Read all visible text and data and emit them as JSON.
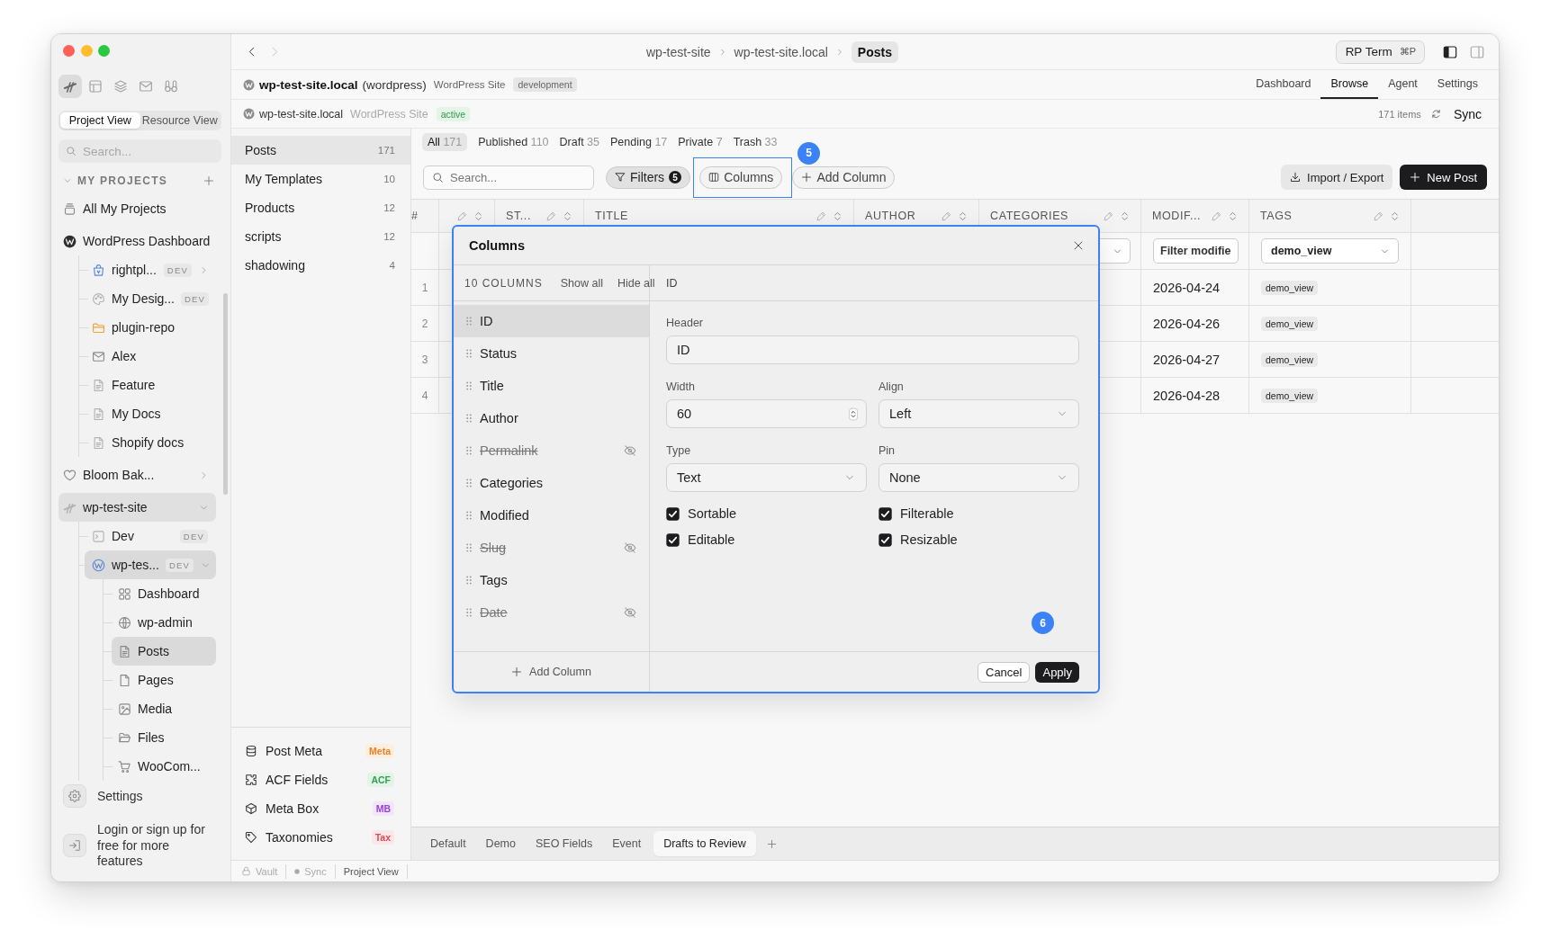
{
  "sidebar": {
    "tools": [
      {
        "kind": "logo",
        "selected": true
      },
      {
        "kind": "layout",
        "selected": false
      },
      {
        "kind": "layers",
        "selected": false
      },
      {
        "kind": "mail",
        "selected": false
      },
      {
        "kind": "binoculars",
        "selected": false
      }
    ],
    "views": [
      {
        "label": "Project View",
        "selected": true
      },
      {
        "label": "Resource View",
        "selected": false
      }
    ],
    "search": {
      "placeholder": "Search..."
    },
    "section": {
      "title": "MY PROJECTS",
      "expanded": true
    },
    "projects": [
      {
        "kind": "all",
        "label": "All My Projects",
        "selected": false
      },
      {
        "kind": "wordpress",
        "label": "WordPress Dashboard",
        "selected": false,
        "children": [
          {
            "kind": "shop",
            "label": "rightpl...",
            "badge": "DEV",
            "expanded": false,
            "selected": false
          },
          {
            "kind": "design",
            "label": "My Desig...",
            "badge": "DEV",
            "selected": false
          },
          {
            "kind": "folder",
            "label": "plugin-repo",
            "selected": false
          },
          {
            "kind": "mail",
            "label": "Alex",
            "selected": false
          },
          {
            "kind": "doc",
            "label": "Feature",
            "selected": false
          },
          {
            "kind": "doc",
            "label": "My Docs",
            "selected": false
          },
          {
            "kind": "doc",
            "label": "Shopify docs",
            "selected": false
          }
        ]
      },
      {
        "kind": "favorite",
        "label": "Bloom Bak...",
        "expanded": false,
        "selected": false
      },
      {
        "kind": "project",
        "label": "wp-test-site",
        "expanded": true,
        "selected": true,
        "children": [
          {
            "kind": "terminal",
            "label": "Dev",
            "badge": "DEV",
            "selected": false
          },
          {
            "kind": "site",
            "label": "wp-tes...",
            "badge": "DEV",
            "expanded": true,
            "selected": true,
            "children": [
              {
                "kind": "dashboard",
                "label": "Dashboard",
                "selected": false
              },
              {
                "kind": "web",
                "label": "wp-admin",
                "selected": false
              },
              {
                "kind": "posts",
                "label": "Posts",
                "selected": true
              },
              {
                "kind": "pages",
                "label": "Pages",
                "selected": false
              },
              {
                "kind": "media",
                "label": "Media",
                "selected": false
              },
              {
                "kind": "files",
                "label": "Files",
                "selected": false
              },
              {
                "kind": "store",
                "label": "WooCom...",
                "selected": false
              }
            ]
          }
        ]
      }
    ],
    "settings": {
      "label": "Settings"
    },
    "login": {
      "text": "Login or sign up for free for more features"
    }
  },
  "topbar": {
    "back": {
      "disabled": false
    },
    "forward": {
      "disabled": true
    },
    "breadcrumbs": [
      {
        "label": "wp-test-site",
        "selected": false
      },
      {
        "label": "wp-test-site.local",
        "selected": false
      },
      {
        "label": "Posts",
        "selected": true
      }
    ],
    "command": {
      "label": "RP Term",
      "shortcut": "⌘P"
    },
    "panels": [
      {
        "kind": "left",
        "on": true
      },
      {
        "kind": "right",
        "on": false
      }
    ]
  },
  "site_header": {
    "name": "wp-test-site.local",
    "platform": "(wordpress)",
    "type": "WordPress Site",
    "environment": "development",
    "tabs": [
      {
        "label": "Dashboard",
        "selected": false
      },
      {
        "label": "Browse",
        "selected": true
      },
      {
        "label": "Agent",
        "selected": false
      },
      {
        "label": "Settings",
        "selected": false
      }
    ]
  },
  "connection": {
    "name": "wp-test-site.local",
    "type": "WordPress Site",
    "status": "active",
    "count": "171 items",
    "action": "Sync"
  },
  "collections": {
    "items": [
      {
        "label": "Posts",
        "count": "171",
        "selected": true
      },
      {
        "label": "My Templates",
        "count": "10",
        "selected": false
      },
      {
        "label": "Products",
        "count": "12",
        "selected": false
      },
      {
        "label": "scripts",
        "count": "12",
        "selected": false
      },
      {
        "label": "shadowing",
        "count": "4",
        "selected": false
      }
    ],
    "extensions": [
      {
        "kind": "database",
        "label": "Post Meta",
        "tag": "Meta",
        "color": "#f07f1e"
      },
      {
        "kind": "puzzle",
        "label": "ACF Fields",
        "tag": "ACF",
        "color": "#2ea44f"
      },
      {
        "kind": "cube",
        "label": "Meta Box",
        "tag": "MB",
        "color": "#9b3fe0"
      },
      {
        "kind": "tag",
        "label": "Taxonomies",
        "tag": "Tax",
        "color": "#e5484d"
      }
    ]
  },
  "browser": {
    "status_tabs": [
      {
        "label": "All",
        "count": "171",
        "selected": true
      },
      {
        "label": "Published",
        "count": "110",
        "selected": false
      },
      {
        "label": "Draft",
        "count": "35",
        "selected": false
      },
      {
        "label": "Pending",
        "count": "17",
        "selected": false
      },
      {
        "label": "Private",
        "count": "7",
        "selected": false
      },
      {
        "label": "Trash",
        "count": "33",
        "selected": false
      }
    ],
    "search": {
      "placeholder": "Search..."
    },
    "filters": {
      "label": "Filters",
      "count": "5",
      "active": true
    },
    "columns_button": {
      "label": "Columns",
      "highlighted": true,
      "callout": "5"
    },
    "add_column": {
      "label": "Add Column"
    },
    "import_export": {
      "label": "Import / Export"
    },
    "new_post": {
      "label": "New Post"
    },
    "table": {
      "columns": [
        {
          "kind": "number",
          "label": "#"
        },
        {
          "kind": "text"
        },
        {
          "kind": "text",
          "label": "ST..."
        },
        {
          "kind": "text",
          "label": "TITLE"
        },
        {
          "kind": "text",
          "label": "AUTHOR"
        },
        {
          "kind": "text",
          "label": "CATEGORIES",
          "filter": {
            "kind": "select"
          }
        },
        {
          "kind": "date",
          "label": "MODIF...",
          "filter": {
            "kind": "input",
            "placeholder": "Filter modifie"
          }
        },
        {
          "kind": "tags",
          "label": "TAGS",
          "filter": {
            "kind": "select",
            "value": "demo_view"
          }
        }
      ],
      "rows": [
        {
          "number": "1",
          "date": "2026-04-24",
          "tags": [
            "demo_view"
          ]
        },
        {
          "number": "2",
          "date": "2026-04-26",
          "tags": [
            "demo_view"
          ]
        },
        {
          "number": "3",
          "date": "2026-04-27",
          "tags": [
            "demo_view"
          ]
        },
        {
          "number": "4",
          "date": "2026-04-28",
          "tags": [
            "demo_view"
          ]
        }
      ]
    },
    "views": [
      {
        "label": "Default",
        "selected": false
      },
      {
        "label": "Demo",
        "selected": false
      },
      {
        "label": "SEO Fields",
        "selected": false
      },
      {
        "label": "Event",
        "selected": false
      },
      {
        "label": "Drafts to Review",
        "selected": true
      }
    ]
  },
  "dialog": {
    "title": "Columns",
    "highlighted": true,
    "callout": "6",
    "count": "10 COLUMNS",
    "show_all": "Show all",
    "hide_all": "Hide all",
    "columns": [
      {
        "label": "ID",
        "selected": true,
        "hidden": false
      },
      {
        "label": "Status",
        "selected": false,
        "hidden": false
      },
      {
        "label": "Title",
        "selected": false,
        "hidden": false
      },
      {
        "label": "Author",
        "selected": false,
        "hidden": false
      },
      {
        "label": "Permalink",
        "selected": false,
        "hidden": true
      },
      {
        "label": "Categories",
        "selected": false,
        "hidden": false
      },
      {
        "label": "Modified",
        "selected": false,
        "hidden": false
      },
      {
        "label": "Slug",
        "selected": false,
        "hidden": true
      },
      {
        "label": "Tags",
        "selected": false,
        "hidden": false
      },
      {
        "label": "Date",
        "selected": false,
        "hidden": true
      }
    ],
    "add_column": "Add Column",
    "detail": {
      "title": "ID",
      "fields": [
        {
          "kind": "text",
          "label": "Header",
          "value": "ID"
        },
        {
          "kind": "number",
          "label": "Width",
          "value": "60"
        },
        {
          "kind": "select",
          "label": "Align",
          "value": "Left"
        },
        {
          "kind": "select",
          "label": "Type",
          "value": "Text"
        },
        {
          "kind": "select",
          "label": "Pin",
          "value": "None"
        }
      ],
      "options": [
        {
          "label": "Sortable",
          "checked": true
        },
        {
          "label": "Filterable",
          "checked": true
        },
        {
          "label": "Editable",
          "checked": true
        },
        {
          "label": "Resizable",
          "checked": true
        }
      ]
    },
    "actions": [
      {
        "kind": "cancel",
        "label": "Cancel"
      },
      {
        "kind": "apply",
        "label": "Apply"
      }
    ]
  },
  "status_bar": {
    "items": [
      {
        "kind": "vault",
        "label": "Vault",
        "disabled": true
      },
      {
        "kind": "sync",
        "label": "Sync",
        "disabled": true
      },
      {
        "kind": "view",
        "label": "Project View",
        "disabled": false
      }
    ]
  }
}
